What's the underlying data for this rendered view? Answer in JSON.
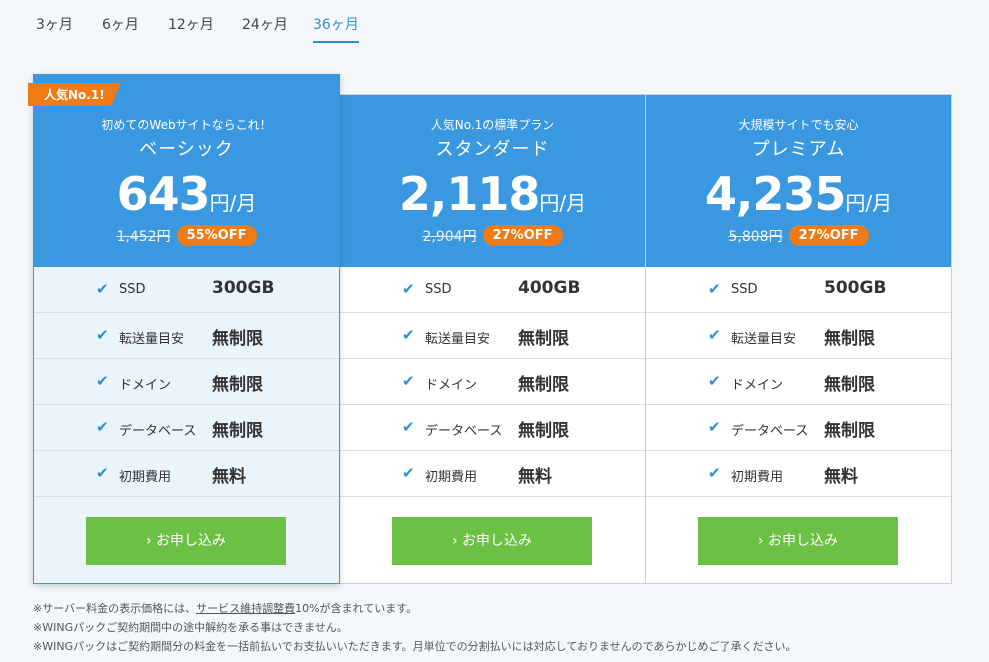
{
  "tabs": [
    {
      "label": "3ヶ月"
    },
    {
      "label": "6ヶ月"
    },
    {
      "label": "12ヶ月"
    },
    {
      "label": "24ヶ月"
    },
    {
      "label": "36ヶ月"
    }
  ],
  "plans": [
    {
      "ribbon": "人気No.1!",
      "tagline": "初めてのWebサイトならこれ！",
      "name": "ベーシック",
      "price": "643",
      "unit": "円/月",
      "old_price": "1,452円",
      "discount": "55%OFF",
      "apply_label": "お申し込み",
      "features": [
        {
          "label": "SSD",
          "value": "300GB"
        },
        {
          "label": "転送量目安",
          "value": "無制限"
        },
        {
          "label": "ドメイン",
          "value": "無制限"
        },
        {
          "label": "データベース",
          "value": "無制限"
        },
        {
          "label": "初期費用",
          "value": "無料"
        }
      ]
    },
    {
      "tagline": "人気No.1の標準プラン",
      "name": "スタンダード",
      "price": "2,118",
      "unit": "円/月",
      "old_price": "2,904円",
      "discount": "27%OFF",
      "apply_label": "お申し込み",
      "features": [
        {
          "label": "SSD",
          "value": "400GB"
        },
        {
          "label": "転送量目安",
          "value": "無制限"
        },
        {
          "label": "ドメイン",
          "value": "無制限"
        },
        {
          "label": "データベース",
          "value": "無制限"
        },
        {
          "label": "初期費用",
          "value": "無料"
        }
      ]
    },
    {
      "tagline": "大規模サイトでも安心",
      "name": "プレミアム",
      "price": "4,235",
      "unit": "円/月",
      "old_price": "5,808円",
      "discount": "27%OFF",
      "apply_label": "お申し込み",
      "features": [
        {
          "label": "SSD",
          "value": "500GB"
        },
        {
          "label": "転送量目安",
          "value": "無制限"
        },
        {
          "label": "ドメイン",
          "value": "無制限"
        },
        {
          "label": "データベース",
          "value": "無制限"
        },
        {
          "label": "初期費用",
          "value": "無料"
        }
      ]
    }
  ],
  "notes": {
    "line1_prefix": "※サーバー料金の表示価格には、",
    "line1_link": "サービス維持調整費",
    "line1_suffix": "10%が含まれています。",
    "line2": "※WINGパックご契約期間中の途中解約を承る事はできません。",
    "line3": "※WINGパックはご契約期間分の料金を一括前払いでお支払いいただきます。月単位での分割払いには対応しておりませんのであらかじめご了承ください。"
  },
  "icons": {
    "check": "check-icon",
    "chevron": "chevron-right-icon"
  },
  "colors": {
    "header_blue": "#3a98e0",
    "accent_orange": "#f07b16",
    "button_green": "#6cc043",
    "tab_active": "#2d8ed8"
  }
}
